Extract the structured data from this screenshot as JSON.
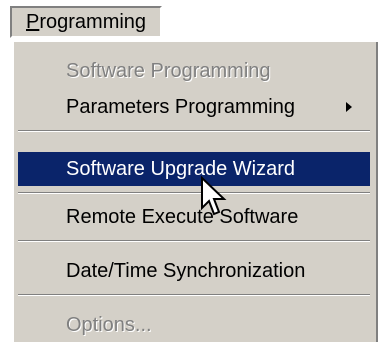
{
  "menubar": {
    "programming_mnemonic": "P",
    "programming_rest": "rogramming"
  },
  "menu": {
    "items": [
      {
        "label": "Software Programming",
        "state": "disabled"
      },
      {
        "label": "Parameters Programming",
        "state": "normal",
        "has_submenu": true
      },
      {
        "label": "Software Upgrade Wizard",
        "state": "highlighted"
      },
      {
        "label": "Remote Execute Software",
        "state": "normal"
      },
      {
        "label": "Date/Time Synchronization",
        "state": "normal"
      },
      {
        "label": "Options...",
        "state": "disabled"
      }
    ],
    "submenu_icon": "chevron-right-icon"
  },
  "cursor": {
    "icon": "mouse-pointer-icon"
  },
  "colors": {
    "menu_bg": "#d4d0c8",
    "highlight_bg": "#0a246a",
    "highlight_text": "#ffffff",
    "disabled_text": "#808080"
  }
}
